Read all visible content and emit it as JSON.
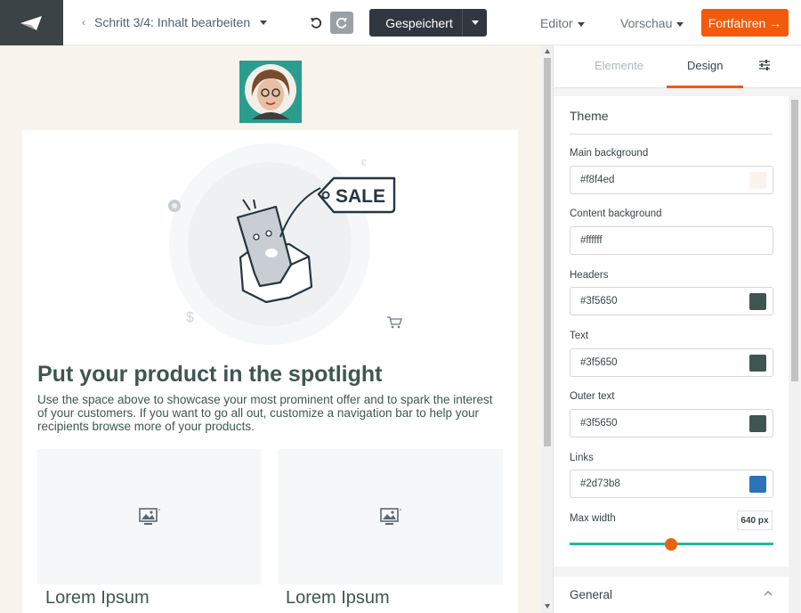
{
  "topbar": {
    "back_glyph": "‹",
    "step_label": "Schritt 3/4: Inhalt bearbeiten",
    "save_label": "Gespeichert",
    "editor_label": "Editor",
    "preview_label": "Vorschau",
    "continue_label": "Fortfahren →",
    "undo_icon": "undo-icon",
    "redo_icon": "redo-icon",
    "accent_color": "#f35a0b"
  },
  "canvas": {
    "hero_tag_text": "SALE",
    "headline": "Put your product in the spotlight",
    "body": "Use the space above to showcase your most prominent offer and to spark the interest of your customers. If you want to go all out, customize a navigation bar to help your recipients browse more of your products.",
    "cards": [
      {
        "title": "Lorem Ipsum"
      },
      {
        "title": "Lorem Ipsum"
      }
    ]
  },
  "panel": {
    "tabs": [
      {
        "label": "Elemente"
      },
      {
        "label": "Design"
      }
    ],
    "theme": {
      "title": "Theme",
      "fields": [
        {
          "label": "Main background",
          "value": "#f8f4ed",
          "swatch": "#f8f4ed"
        },
        {
          "label": "Content background",
          "value": "#ffffff",
          "swatch": ""
        },
        {
          "label": "Headers",
          "value": "#3f5650",
          "swatch": "#3f5650"
        },
        {
          "label": "Text",
          "value": "#3f5650",
          "swatch": "#3f5650"
        },
        {
          "label": "Outer text",
          "value": "#3f5650",
          "swatch": "#3f5650"
        },
        {
          "label": "Links",
          "value": "#2d73b8",
          "swatch": "#2d73b8"
        }
      ],
      "max_width_label": "Max width",
      "max_width_value": "640 px"
    },
    "general_label": "General"
  }
}
